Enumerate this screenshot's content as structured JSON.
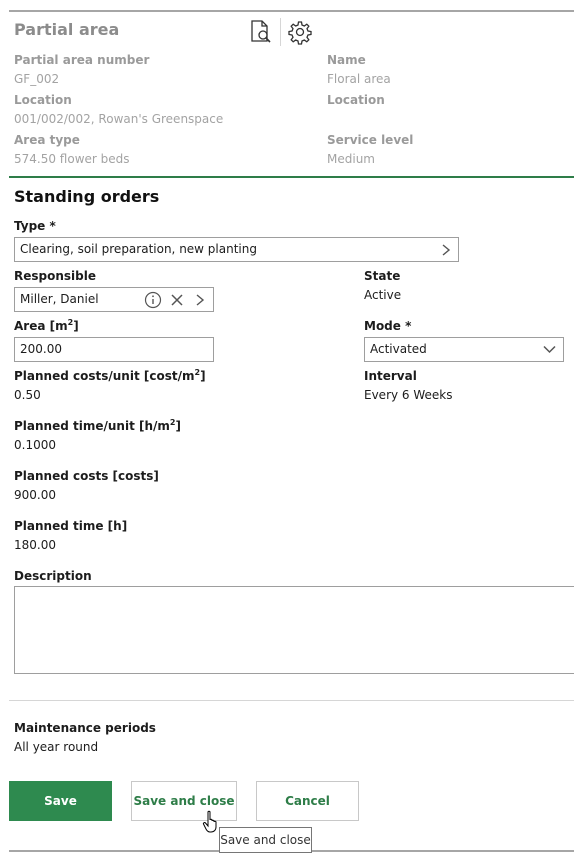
{
  "header": {
    "title": "Partial area",
    "icons": [
      "document-search-icon",
      "gear-icon"
    ]
  },
  "general": {
    "partial_area_number_label": "Partial area number",
    "partial_area_number": "GF_002",
    "name_label": "Name",
    "name": "Floral area",
    "location_label": "Location",
    "location": "001/002/002, Rowan's Greenspace",
    "location_label_right": "Location",
    "area_type_label": "Area type",
    "area_type": "574.50 flower beds",
    "service_level_label": "Service level",
    "service_level": "Medium"
  },
  "standing_orders": {
    "title": "Standing orders",
    "type_label": "Type *",
    "type_value": "Clearing, soil preparation, new planting",
    "responsible_label": "Responsible",
    "responsible_value": "Miller, Daniel",
    "state_label": "State",
    "state_value": "Active",
    "area_label": "Area [m",
    "area_label_sup": "2",
    "area_label_end": "]",
    "area_value": "200.00",
    "mode_label": "Mode *",
    "mode_value": "Activated",
    "planned_costs_unit_label": "Planned costs/unit [cost/m",
    "planned_costs_unit_sup": "2",
    "planned_costs_unit_end": "]",
    "planned_costs_unit_value": "0.50",
    "interval_label": "Interval",
    "interval_value": "Every 6 Weeks",
    "planned_time_unit_label": "Planned time/unit [h/m",
    "planned_time_unit_sup": "2",
    "planned_time_unit_end": "]",
    "planned_time_unit_value": "0.1000",
    "planned_costs_label": "Planned costs [costs]",
    "planned_costs_value": "900.00",
    "planned_time_label": "Planned time [h]",
    "planned_time_value": "180.00",
    "description_label": "Description",
    "description_value": ""
  },
  "maintenance": {
    "label": "Maintenance periods",
    "value": "All year round"
  },
  "buttons": {
    "save": "Save",
    "save_and_close": "Save and close",
    "cancel": "Cancel"
  },
  "tooltip": {
    "text": "Save and close"
  },
  "colors": {
    "accent_green": "#2e8a4f",
    "divider_green": "#2e7d48"
  }
}
